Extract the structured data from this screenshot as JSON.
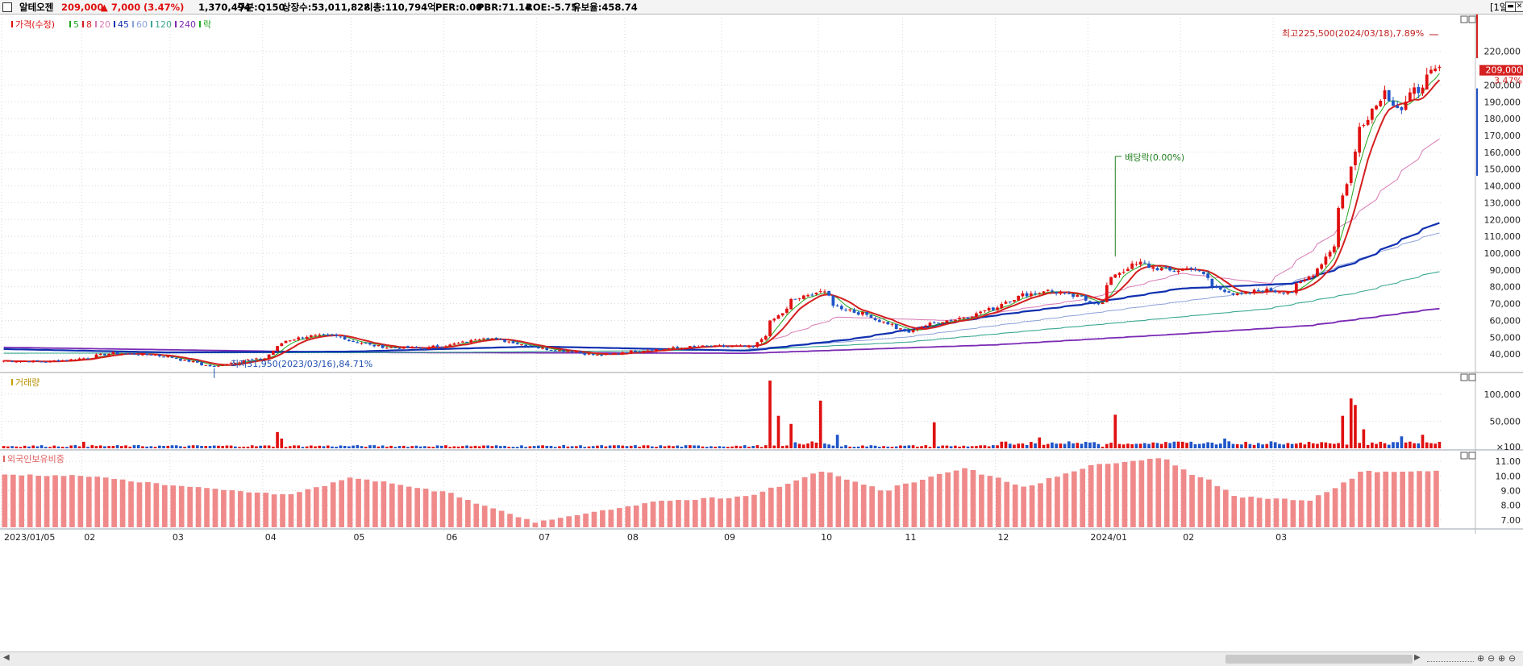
{
  "header": {
    "stock_name": "알테오젠",
    "price": "209,000",
    "change": "▲ 7,000",
    "change_pct": "(3.47%)",
    "volume": "1,370,494",
    "market": "구분:Q150",
    "listed_shares": "상장수:53,011,828",
    "market_cap": "시총:110,794억",
    "per": "PER:0.00",
    "pbr": "PBR:71.14",
    "roe": "ROE:-5.75",
    "reserve_ratio": "유보율:458.74",
    "period_button": "[1일]",
    "minimize_icon": "minimize-icon",
    "close_icon": "close-icon"
  },
  "colors": {
    "up": "#e01010",
    "down": "#1f55c8",
    "ma5": "#1fa61f",
    "ma8": "#d42020",
    "ma20": "#d87ab4",
    "ma45": "#1030b0",
    "ma60": "#8ca0d8",
    "ma120": "#38a890",
    "ma240": "#7a2ab4",
    "foreign": "#f08a8a",
    "grid": "#d8d8d8",
    "panel_line": "#9aa0aa"
  },
  "chart_data": [
    {
      "type": "candlestick",
      "title": "가격(수정)",
      "legend": [
        {
          "name": "가격(수정)",
          "color": "#e01010"
        },
        {
          "name": "5",
          "color": "#1fa61f"
        },
        {
          "name": "8",
          "color": "#d42020"
        },
        {
          "name": "20",
          "color": "#d87ab4"
        },
        {
          "name": "45",
          "color": "#1030b0"
        },
        {
          "name": "60",
          "color": "#8ca0d8"
        },
        {
          "name": "120",
          "color": "#38a890"
        },
        {
          "name": "240",
          "color": "#7a2ab4"
        },
        {
          "name": "락",
          "color": "#1fa61f"
        }
      ],
      "x_range": [
        "2023/01/05",
        "2024/03/22"
      ],
      "ylim": [
        30000,
        240000
      ],
      "y_ticks": [
        "40,000",
        "50,000",
        "60,000",
        "70,000",
        "80,000",
        "90,000",
        "100,000",
        "110,000",
        "120,000",
        "130,000",
        "140,000",
        "150,000",
        "160,000",
        "170,000",
        "180,000",
        "190,000",
        "200,000",
        "220,000"
      ],
      "current_price": "209,000",
      "current_change": "3.47%",
      "annotations": {
        "high": "최고225,500(2024/03/18),7.89%",
        "low": "최저31,950(2023/03/16),84.71%",
        "dividend": "배당락(0.00%)"
      },
      "price_path": [
        [
          "2023/01/05",
          36000
        ],
        [
          "2023/01/20",
          35500
        ],
        [
          "2023/02/01",
          37500
        ],
        [
          "2023/02/10",
          40500
        ],
        [
          "2023/02/25",
          39500
        ],
        [
          "2023/03/05",
          37000
        ],
        [
          "2023/03/16",
          32500
        ],
        [
          "2023/03/25",
          36000
        ],
        [
          "2023/04/03",
          37500
        ],
        [
          "2023/04/07",
          46500
        ],
        [
          "2023/04/15",
          50500
        ],
        [
          "2023/04/25",
          51000
        ],
        [
          "2023/05/03",
          47000
        ],
        [
          "2023/05/12",
          44000
        ],
        [
          "2023/05/25",
          43500
        ],
        [
          "2023/06/05",
          46000
        ],
        [
          "2023/06/14",
          50000
        ],
        [
          "2023/06/25",
          46500
        ],
        [
          "2023/07/05",
          43000
        ],
        [
          "2023/07/14",
          41500
        ],
        [
          "2023/07/22",
          39000
        ],
        [
          "2023/08/01",
          41500
        ],
        [
          "2023/08/12",
          43000
        ],
        [
          "2023/08/25",
          44500
        ],
        [
          "2023/09/05",
          44500
        ],
        [
          "2023/09/12",
          44000
        ],
        [
          "2023/09/18",
          59000
        ],
        [
          "2023/09/25",
          72000
        ],
        [
          "2023/10/04",
          77500
        ],
        [
          "2023/10/10",
          68000
        ],
        [
          "2023/10/18",
          64000
        ],
        [
          "2023/10/25",
          59000
        ],
        [
          "2023/11/02",
          53000
        ],
        [
          "2023/11/10",
          58500
        ],
        [
          "2023/11/20",
          61500
        ],
        [
          "2023/11/30",
          67000
        ],
        [
          "2023/12/08",
          74000
        ],
        [
          "2023/12/18",
          78000
        ],
        [
          "2023/12/28",
          74000
        ],
        [
          "2024/01/05",
          70000
        ],
        [
          "2024/01/10",
          88000
        ],
        [
          "2024/01/18",
          94000
        ],
        [
          "2024/01/28",
          89000
        ],
        [
          "2024/02/05",
          92000
        ],
        [
          "2024/02/12",
          80000
        ],
        [
          "2024/02/20",
          75000
        ],
        [
          "2024/02/28",
          78000
        ],
        [
          "2024/03/08",
          77000
        ],
        [
          "2024/03/12",
          82000
        ],
        [
          "2024/03/15",
          88000
        ],
        [
          "2024/03/18",
          91000
        ],
        [
          "2024/03/22",
          105000
        ],
        [
          "2024/03/26",
          134000
        ],
        [
          "2024/03/30",
          168000
        ],
        [
          "2024/04/04",
          186000
        ],
        [
          "2024/04/09",
          196000
        ],
        [
          "2024/04/14",
          182000
        ],
        [
          "2024/04/18",
          196000
        ],
        [
          "2024/04/22",
          202000
        ],
        [
          "2024/04/26",
          209000
        ]
      ],
      "moving_averages": {
        "45": [
          [
            "2023/01/05",
            43000
          ],
          [
            "2023/03/01",
            41000
          ],
          [
            "2023/05/01",
            41500
          ],
          [
            "2023/07/01",
            44500
          ],
          [
            "2023/09/10",
            42000
          ],
          [
            "2023/10/15",
            49000
          ],
          [
            "2023/12/01",
            63000
          ],
          [
            "2024/01/01",
            70000
          ],
          [
            "2024/02/01",
            79000
          ],
          [
            "2024/03/10",
            82000
          ],
          [
            "2024/04/01",
            96000
          ],
          [
            "2024/04/26",
            118000
          ]
        ],
        "120": [
          [
            "2023/01/05",
            40500
          ],
          [
            "2023/06/01",
            41000
          ],
          [
            "2023/09/10",
            42500
          ],
          [
            "2023/11/01",
            47000
          ],
          [
            "2024/01/01",
            57000
          ],
          [
            "2024/03/01",
            67000
          ],
          [
            "2024/04/01",
            77000
          ],
          [
            "2024/04/26",
            89000
          ]
        ],
        "240": [
          [
            "2023/01/05",
            44000
          ],
          [
            "2023/05/01",
            41000
          ],
          [
            "2023/09/10",
            40500
          ],
          [
            "2023/12/01",
            45500
          ],
          [
            "2024/02/01",
            52000
          ],
          [
            "2024/03/15",
            57000
          ],
          [
            "2024/04/26",
            67000
          ]
        ],
        "60": [
          [
            "2023/09/10",
            43000
          ],
          [
            "2023/11/01",
            50000
          ],
          [
            "2024/01/01",
            64000
          ],
          [
            "2024/03/01",
            78000
          ],
          [
            "2024/04/26",
            112000
          ]
        ],
        "20": [
          [
            "2023/09/10",
            43500
          ],
          [
            "2023/10/10",
            62000
          ],
          [
            "2023/11/15",
            60000
          ],
          [
            "2024/01/01",
            73000
          ],
          [
            "2024/02/01",
            88000
          ],
          [
            "2024/03/01",
            82000
          ],
          [
            "2024/04/01",
            125000
          ],
          [
            "2024/04/26",
            168000
          ]
        ]
      }
    },
    {
      "type": "bar",
      "title": "거래량",
      "y_ticks": [
        "×100",
        "50,000",
        "100,000"
      ],
      "ylim": [
        0,
        125000
      ],
      "spikes": [
        [
          "2023/02/01",
          12000
        ],
        [
          "2023/04/06",
          30000
        ],
        [
          "2023/04/07",
          18000
        ],
        [
          "2023/09/18",
          125000
        ],
        [
          "2023/09/20",
          60000
        ],
        [
          "2023/09/25",
          45000
        ],
        [
          "2023/10/04",
          88000
        ],
        [
          "2023/10/10",
          25000
        ],
        [
          "2023/11/10",
          48000
        ],
        [
          "2023/12/15",
          20000
        ],
        [
          "2024/01/10",
          62000
        ],
        [
          "2024/02/15",
          18000
        ],
        [
          "2024/03/26",
          60000
        ],
        [
          "2024/03/28",
          92000
        ],
        [
          "2024/03/30",
          80000
        ],
        [
          "2024/04/02",
          35000
        ],
        [
          "2024/04/15",
          22000
        ],
        [
          "2024/04/22",
          25000
        ]
      ]
    },
    {
      "type": "bar",
      "title": "외국인보유비중",
      "y_ticks": [
        "7.00",
        "8.00",
        "9.00",
        "10.00",
        "11.00"
      ],
      "ylim": [
        6.5,
        11.5
      ],
      "path": [
        [
          "2023/01/05",
          10.1
        ],
        [
          "2023/02/01",
          10.0
        ],
        [
          "2023/03/15",
          9.1
        ],
        [
          "2023/04/10",
          8.7
        ],
        [
          "2023/05/01",
          9.9
        ],
        [
          "2023/06/01",
          8.9
        ],
        [
          "2023/07/01",
          6.8
        ],
        [
          "2023/08/10",
          8.3
        ],
        [
          "2023/09/10",
          8.6
        ],
        [
          "2023/10/04",
          10.3
        ],
        [
          "2023/10/25",
          9.0
        ],
        [
          "2023/11/20",
          10.6
        ],
        [
          "2023/12/10",
          9.2
        ],
        [
          "2024/01/01",
          10.7
        ],
        [
          "2024/01/25",
          11.2
        ],
        [
          "2024/02/20",
          8.6
        ],
        [
          "2024/03/15",
          8.3
        ],
        [
          "2024/04/01",
          10.3
        ],
        [
          "2024/04/26",
          10.3
        ]
      ]
    }
  ],
  "x_axis_labels": [
    [
      "2023/01/05",
      "2023/01/05"
    ],
    [
      "02",
      "2023/02/01"
    ],
    [
      "03",
      "2023/03/02"
    ],
    [
      "04",
      "2023/04/03"
    ],
    [
      "05",
      "2023/05/02"
    ],
    [
      "06",
      "2023/06/01"
    ],
    [
      "07",
      "2023/07/03"
    ],
    [
      "08",
      "2023/08/01"
    ],
    [
      "09",
      "2023/09/01"
    ],
    [
      "10",
      "2023/10/04"
    ],
    [
      "11",
      "2023/11/01"
    ],
    [
      "12",
      "2023/12/01"
    ],
    [
      "2024/01",
      "2024/01/02"
    ],
    [
      "02",
      "2024/02/01"
    ],
    [
      "03",
      "2024/03/04"
    ]
  ],
  "panels": {
    "price_label": "가격(수정)",
    "volume_label": "거래량",
    "foreign_label": "외국인보유비중"
  }
}
